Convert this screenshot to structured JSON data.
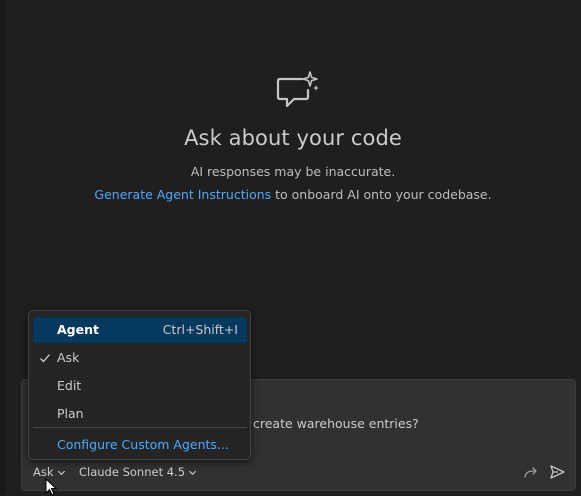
{
  "welcome": {
    "title": "Ask about your code",
    "subtitle": "AI responses may be inaccurate.",
    "instructions_link": "Generate Agent Instructions",
    "instructions_rest": " to onboard AI onto your codebase."
  },
  "input": {
    "text_fragment": "create warehouse entries?"
  },
  "toolbar": {
    "mode_label": "Ask",
    "model_label": "Claude Sonnet 4.5"
  },
  "mode_menu": {
    "items": [
      {
        "label": "Agent",
        "shortcut": "Ctrl+Shift+I",
        "highlighted": true,
        "checked": false
      },
      {
        "label": "Ask",
        "shortcut": "",
        "highlighted": false,
        "checked": true
      },
      {
        "label": "Edit",
        "shortcut": "",
        "highlighted": false,
        "checked": false
      },
      {
        "label": "Plan",
        "shortcut": "",
        "highlighted": false,
        "checked": false
      }
    ],
    "configure_label": "Configure Custom Agents..."
  },
  "icons": {
    "welcome": "chat-sparkle-icon",
    "check": "check-icon",
    "chevron": "chevron-down-icon",
    "forward": "forward-arrow-icon",
    "send": "send-icon"
  },
  "colors": {
    "background": "#1f1f1f",
    "input_background": "#313131",
    "menu_background": "#252526",
    "highlight": "#04395e",
    "link": "#4daafc"
  }
}
